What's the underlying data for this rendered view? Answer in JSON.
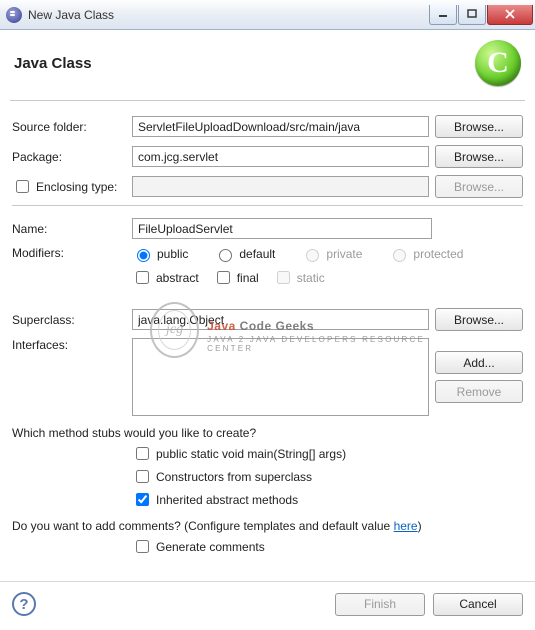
{
  "window": {
    "title": "New Java Class"
  },
  "banner": {
    "heading": "Java Class",
    "icon_letter": "C"
  },
  "fields": {
    "source_folder": {
      "label": "Source folder:",
      "value": "ServletFileUploadDownload/src/main/java",
      "browse": "Browse..."
    },
    "package": {
      "label": "Package:",
      "value": "com.jcg.servlet",
      "browse": "Browse..."
    },
    "enclosing": {
      "label": "Enclosing type:",
      "value": "",
      "browse": "Browse..."
    },
    "name": {
      "label": "Name:",
      "value": "FileUploadServlet"
    },
    "modifiers": {
      "label": "Modifiers:",
      "public": "public",
      "default": "default",
      "private": "private",
      "protected": "protected",
      "abstract": "abstract",
      "final": "final",
      "static": "static"
    },
    "superclass": {
      "label": "Superclass:",
      "value": "java.lang.Object",
      "browse": "Browse..."
    },
    "interfaces": {
      "label": "Interfaces:",
      "add": "Add...",
      "remove": "Remove"
    }
  },
  "stubs": {
    "question": "Which method stubs would you like to create?",
    "main": "public static void main(String[] args)",
    "constructors": "Constructors from superclass",
    "inherited": "Inherited abstract methods"
  },
  "comments": {
    "question_pre": "Do you want to add comments? (Configure templates and default value ",
    "link": "here",
    "question_post": ")",
    "generate": "Generate comments"
  },
  "footer": {
    "help": "?",
    "finish": "Finish",
    "cancel": "Cancel"
  },
  "watermark": {
    "jcg": "jcg",
    "t1a": "Java",
    "t1b": " Code Geeks",
    "t2": "JAVA 2 JAVA DEVELOPERS RESOURCE CENTER"
  }
}
